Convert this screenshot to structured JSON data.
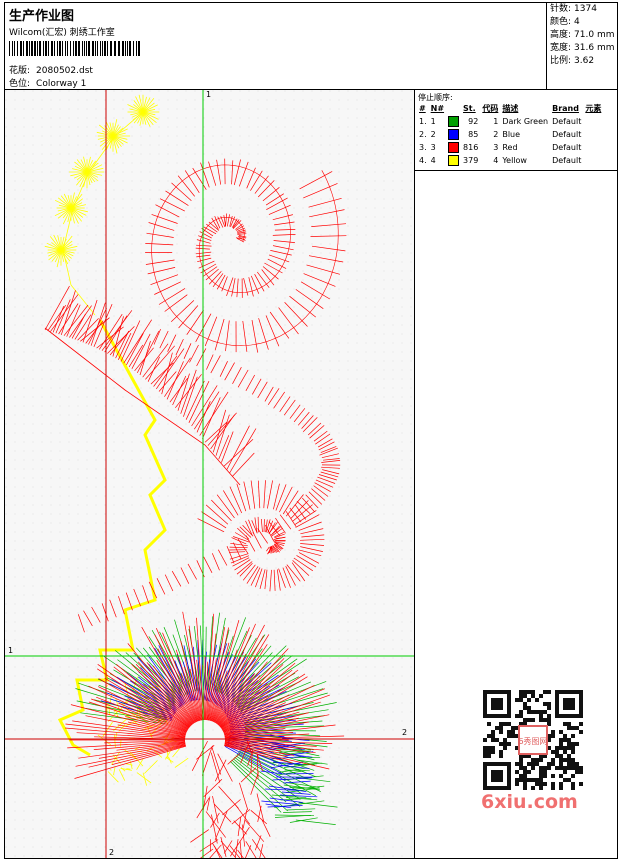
{
  "header": {
    "title": "生产作业图",
    "studio": "Wilcom(汇宏) 刺绣工作室",
    "design_label": "花版:",
    "design_file": "2080502.dst",
    "colorway_label": "色位:",
    "colorway": "Colorway 1"
  },
  "stats": {
    "stitches_label": "针数:",
    "stitches": "1374",
    "colors_label": "颜色:",
    "colors": "4",
    "height_label": "高度:",
    "height": "71.0 mm",
    "width_label": "宽度:",
    "width": "31.6 mm",
    "ratio_label": "比例:",
    "ratio": "3.62"
  },
  "color_panel": {
    "title": "停止顺序:",
    "headers": [
      "#",
      "N#",
      "St.",
      "代码",
      "描述",
      "Brand",
      "元素"
    ],
    "rows": [
      {
        "idx": "1.",
        "n": "1",
        "color": "#00a000",
        "st": "92",
        "code": "1",
        "desc": "Dark Green",
        "brand": "Default"
      },
      {
        "idx": "2.",
        "n": "2",
        "color": "#0000ff",
        "st": "85",
        "code": "2",
        "desc": "Blue",
        "brand": "Default"
      },
      {
        "idx": "3.",
        "n": "3",
        "color": "#ff0000",
        "st": "816",
        "code": "3",
        "desc": "Red",
        "brand": "Default"
      },
      {
        "idx": "4.",
        "n": "4",
        "color": "#ffff00",
        "st": "379",
        "code": "4",
        "desc": "Yellow",
        "brand": "Default"
      }
    ]
  },
  "axes": {
    "v1": "1",
    "h1": "1",
    "h2": "2",
    "v2": "2"
  },
  "watermark": "6xiu.com",
  "qr_stamp": "6秀图网",
  "palette": {
    "red": "#ff0000",
    "yellow": "#ffff00",
    "green": "#00b000",
    "blue": "#0000ff",
    "guide_green": "#00cc00",
    "guide_red": "#cc0000"
  }
}
